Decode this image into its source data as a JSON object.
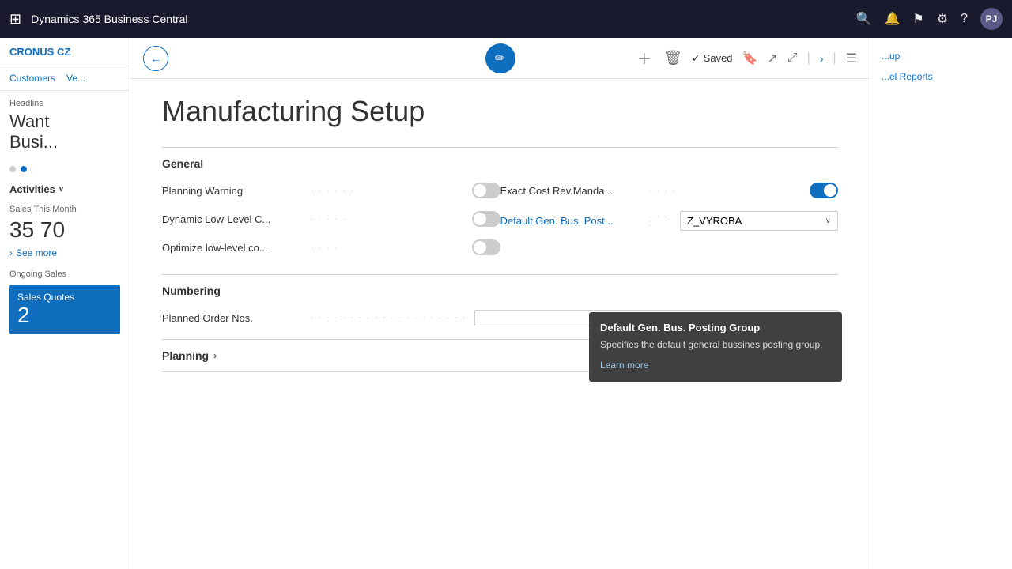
{
  "topbar": {
    "title": "Dynamics 365 Business Central",
    "avatar_text": "PJ"
  },
  "sidebar": {
    "company": "CRONUS CZ",
    "nav_items": [
      "Customers",
      "Ve..."
    ],
    "headline": "Headline",
    "big_text_line1": "Want",
    "big_text_line2": "Busi...",
    "activities_label": "Activities",
    "sales_this_month": "Sales This Month",
    "sales_number": "35 70",
    "see_more": "See more",
    "ongoing_sales": "Ongoing Sales",
    "sales_quotes_label": "Sales Quotes",
    "sales_quotes_number": "2"
  },
  "toolbar": {
    "saved_label": "Saved",
    "more_label": "..."
  },
  "page": {
    "title": "Manufacturing Setup",
    "sections": {
      "general": "General",
      "numbering": "Numbering",
      "planning": "Planning"
    },
    "fields": {
      "planning_warning": "Planning Warning",
      "dynamic_low_level": "Dynamic Low-Level C...",
      "optimize_low_level": "Optimize low-level co...",
      "exact_cost_rev": "Exact Cost Rev.Manda...",
      "default_gen_bus": "Default Gen. Bus. Post...",
      "default_gen_bus_value": "Z_VYROBA",
      "planned_order_nos": "Planned Order Nos."
    },
    "toggles": {
      "planning_warning_on": false,
      "dynamic_low_level_on": false,
      "optimize_low_level_on": false,
      "exact_cost_rev_on": true
    }
  },
  "tooltip": {
    "title": "Default Gen. Bus. Posting Group",
    "description": "Specifies the default general bussines posting group.",
    "link": "Learn more"
  },
  "right_panel": {
    "links": [
      "...up",
      "...el Reports"
    ]
  }
}
